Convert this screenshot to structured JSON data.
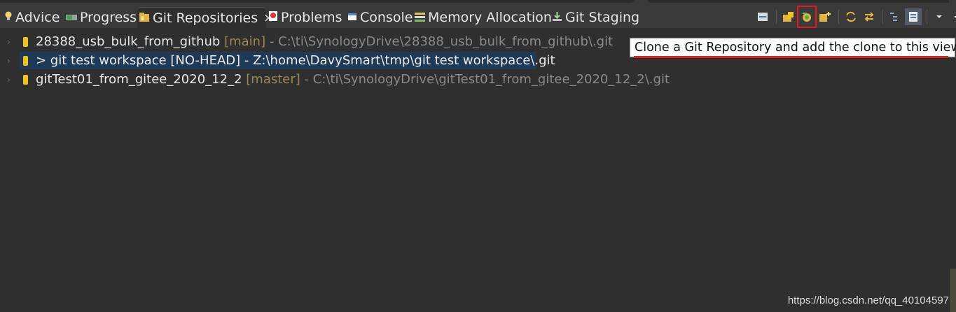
{
  "tabs": [
    {
      "label": "Advice",
      "icon": "lightbulb-icon"
    },
    {
      "label": "Progress",
      "icon": "progress-icon"
    },
    {
      "label": "Git Repositories",
      "icon": "git-repositories-icon",
      "active": true
    },
    {
      "label": "Problems",
      "icon": "problems-icon"
    },
    {
      "label": "Console",
      "icon": "console-icon"
    },
    {
      "label": "Memory Allocation",
      "icon": "memory-allocation-icon"
    },
    {
      "label": "Git Staging",
      "icon": "git-staging-icon"
    }
  ],
  "close_glyph": "×",
  "toolbar": {
    "buttons": [
      "collapse-all-icon",
      "add-existing-repository-icon",
      "clone-repository-icon",
      "create-repository-icon",
      "refresh-icon",
      "link-with-selection-icon",
      "hierarchical-view-icon",
      "toggle-view-icon",
      "view-menu-icon",
      "minimize-icon",
      "maximize-icon"
    ]
  },
  "repositories": [
    {
      "name": "28388_usb_bulk_from_github",
      "branch": "[main]",
      "path": "- C:\\ti\\SynologyDrive\\28388_usb_bulk_from_github\\.git",
      "selected": false
    },
    {
      "name": "> git test workspace [NO-HEAD] - Z:\\home\\DavySmart\\tmp\\git test workspace\\.git",
      "branch": "",
      "path": "",
      "selected": true
    },
    {
      "name": "gitTest01_from_gitee_2020_12_2",
      "branch": "[master]",
      "path": "- C:\\ti\\SynologyDrive\\gitTest01_from_gitee_2020_12_2\\.git",
      "selected": false
    }
  ],
  "tooltip": "Clone a Git Repository and add the clone to this view",
  "watermark": "https://blog.csdn.net/qq_40104597",
  "colors": {
    "background": "#2f2f2f",
    "selection": "#1f3a56",
    "branch": "#9e8650",
    "path": "#8a8a8a",
    "highlight_red": "#e11b1b"
  }
}
